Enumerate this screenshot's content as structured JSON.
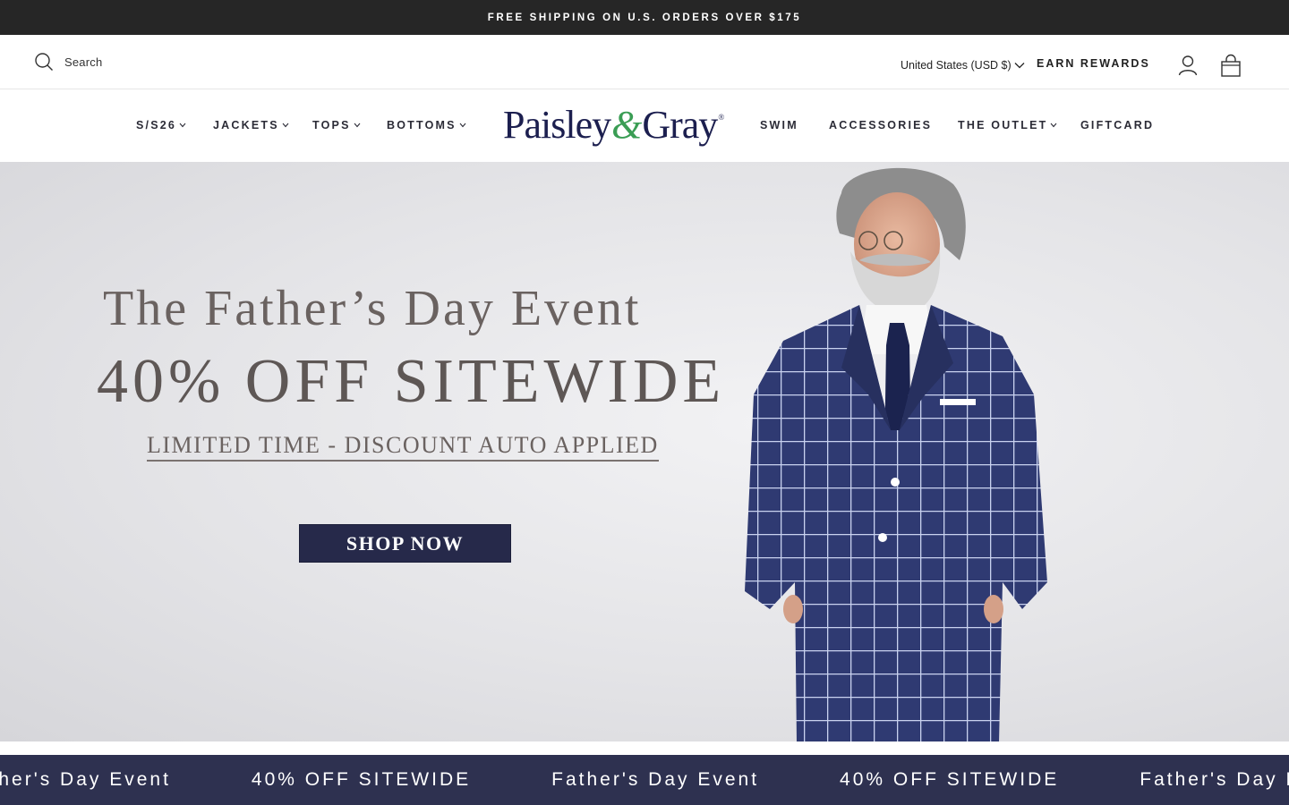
{
  "announcement": "FREE SHIPPING ON U.S. ORDERS OVER $175",
  "utility": {
    "search_label": "Search",
    "currency": "United States (USD $)",
    "rewards": "EARN REWARDS"
  },
  "nav": {
    "left": [
      {
        "label": "S/S26",
        "dropdown": true
      },
      {
        "label": "JACKETS",
        "dropdown": true
      },
      {
        "label": "TOPS",
        "dropdown": true
      },
      {
        "label": "BOTTOMS",
        "dropdown": true
      }
    ],
    "right": [
      {
        "label": "SWIM",
        "dropdown": false
      },
      {
        "label": "ACCESSORIES",
        "dropdown": false
      },
      {
        "label": "THE OUTLET",
        "dropdown": true
      },
      {
        "label": "GIFTCARD",
        "dropdown": false
      }
    ]
  },
  "logo": {
    "part1": "Paisley",
    "amp": "&",
    "part2": "Gray",
    "reg": "®"
  },
  "hero": {
    "line1": "The Father’s Day Event",
    "line2": "40% OFF SITEWIDE",
    "line3": "LIMITED TIME - DISCOUNT AUTO APPLIED",
    "cta": "SHOP NOW"
  },
  "marquee": [
    "Father's Day Event",
    "40% OFF SITEWIDE",
    "Father's Day Event",
    "40% OFF SITEWIDE",
    "Father's Day Event"
  ],
  "colors": {
    "announcement_bg": "#262626",
    "brand_navy": "#1c1f4f",
    "brand_green": "#3a9d54",
    "cta_bg": "#26294a",
    "marquee_bg": "#2e3150"
  }
}
